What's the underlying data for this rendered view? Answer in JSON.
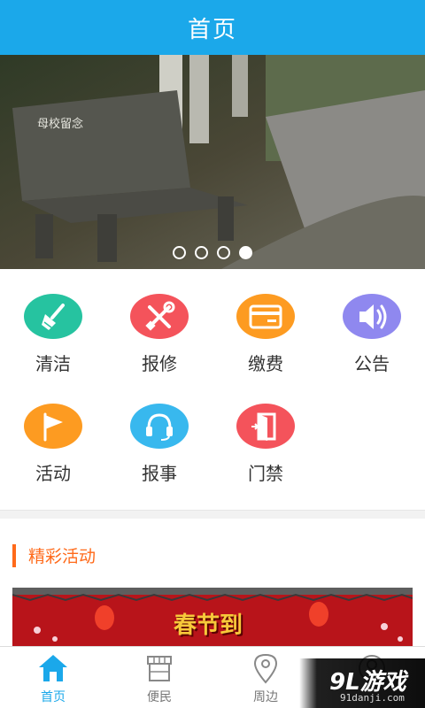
{
  "header": {
    "title": "首页"
  },
  "banner": {
    "bench_text": "母校留念",
    "slides": [
      {
        "active": false
      },
      {
        "active": false
      },
      {
        "active": false
      },
      {
        "active": true
      }
    ]
  },
  "grid": {
    "items": [
      {
        "label": "清洁",
        "icon": "broom-icon",
        "color": "#26c3a0"
      },
      {
        "label": "报修",
        "icon": "tools-icon",
        "color": "#f4535b"
      },
      {
        "label": "缴费",
        "icon": "card-icon",
        "color": "#fd9b21"
      },
      {
        "label": "公告",
        "icon": "speaker-icon",
        "color": "#8f88ef"
      },
      {
        "label": "活动",
        "icon": "flag-icon",
        "color": "#fd9b21"
      },
      {
        "label": "报事",
        "icon": "headset-icon",
        "color": "#38b8ee"
      },
      {
        "label": "门禁",
        "icon": "door-icon",
        "color": "#f4535b"
      }
    ]
  },
  "section": {
    "title": "精彩活动"
  },
  "promo": {
    "headline": "春节到"
  },
  "tabbar": {
    "tabs": [
      {
        "label": "首页",
        "icon": "home-icon",
        "active": true
      },
      {
        "label": "便民",
        "icon": "shop-icon",
        "active": false
      },
      {
        "label": "周边",
        "icon": "location-pin-icon",
        "active": false
      },
      {
        "label": "",
        "icon": "user-icon",
        "active": false
      }
    ]
  },
  "watermark": {
    "logo": "9L游戏",
    "url": "91danji.com"
  },
  "colors": {
    "primary": "#1ba8ea",
    "accent": "#ff6a1a"
  }
}
